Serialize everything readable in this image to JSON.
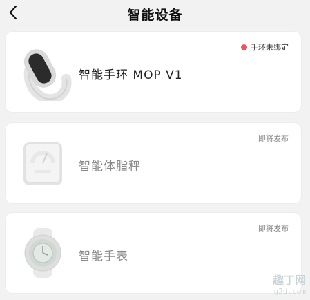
{
  "header": {
    "title": "智能设备",
    "back_icon": "chevron-left-icon"
  },
  "devices": [
    {
      "name": "智能手环  MOP V1",
      "status": "手环未绑定",
      "status_color": "#f0545a",
      "icon": "band-icon"
    },
    {
      "name": "智能体脂秤",
      "status": "即将发布",
      "icon": "scale-icon"
    },
    {
      "name": "智能手表",
      "status": "即将发布",
      "icon": "watch-icon"
    }
  ],
  "watermark": {
    "line1": "趣丁网",
    "line2": "q2d.com"
  }
}
